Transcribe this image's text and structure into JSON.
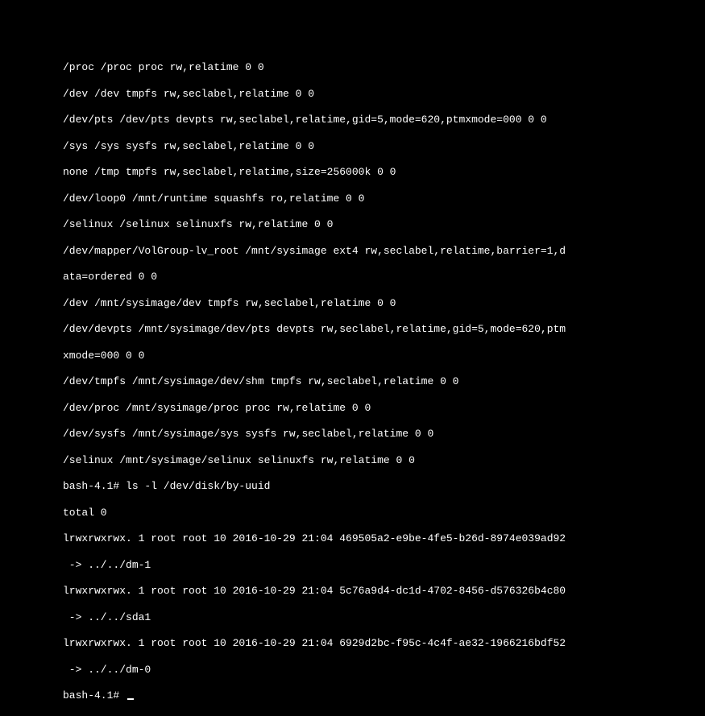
{
  "lines": [
    "/proc /proc proc rw,relatime 0 0",
    "/dev /dev tmpfs rw,seclabel,relatime 0 0",
    "/dev/pts /dev/pts devpts rw,seclabel,relatime,gid=5,mode=620,ptmxmode=000 0 0",
    "/sys /sys sysfs rw,seclabel,relatime 0 0",
    "none /tmp tmpfs rw,seclabel,relatime,size=256000k 0 0",
    "/dev/loop0 /mnt/runtime squashfs ro,relatime 0 0",
    "/selinux /selinux selinuxfs rw,relatime 0 0",
    "/dev/mapper/VolGroup-lv_root /mnt/sysimage ext4 rw,seclabel,relatime,barrier=1,d",
    "ata=ordered 0 0",
    "/dev /mnt/sysimage/dev tmpfs rw,seclabel,relatime 0 0",
    "/dev/devpts /mnt/sysimage/dev/pts devpts rw,seclabel,relatime,gid=5,mode=620,ptm",
    "xmode=000 0 0",
    "/dev/tmpfs /mnt/sysimage/dev/shm tmpfs rw,seclabel,relatime 0 0",
    "/dev/proc /mnt/sysimage/proc proc rw,relatime 0 0",
    "/dev/sysfs /mnt/sysimage/sys sysfs rw,seclabel,relatime 0 0",
    "/selinux /mnt/sysimage/selinux selinuxfs rw,relatime 0 0",
    "bash-4.1# ls -l /dev/disk/by-uuid",
    "total 0",
    "lrwxrwxrwx. 1 root root 10 2016-10-29 21:04 469505a2-e9be-4fe5-b26d-8974e039ad92",
    " -> ../../dm-1",
    "lrwxrwxrwx. 1 root root 10 2016-10-29 21:04 5c76a9d4-dc1d-4702-8456-d576326b4c80",
    " -> ../../sda1",
    "lrwxrwxrwx. 1 root root 10 2016-10-29 21:04 6929d2bc-f95c-4c4f-ae32-1966216bdf52",
    " -> ../../dm-0"
  ],
  "prompt": "bash-4.1# "
}
